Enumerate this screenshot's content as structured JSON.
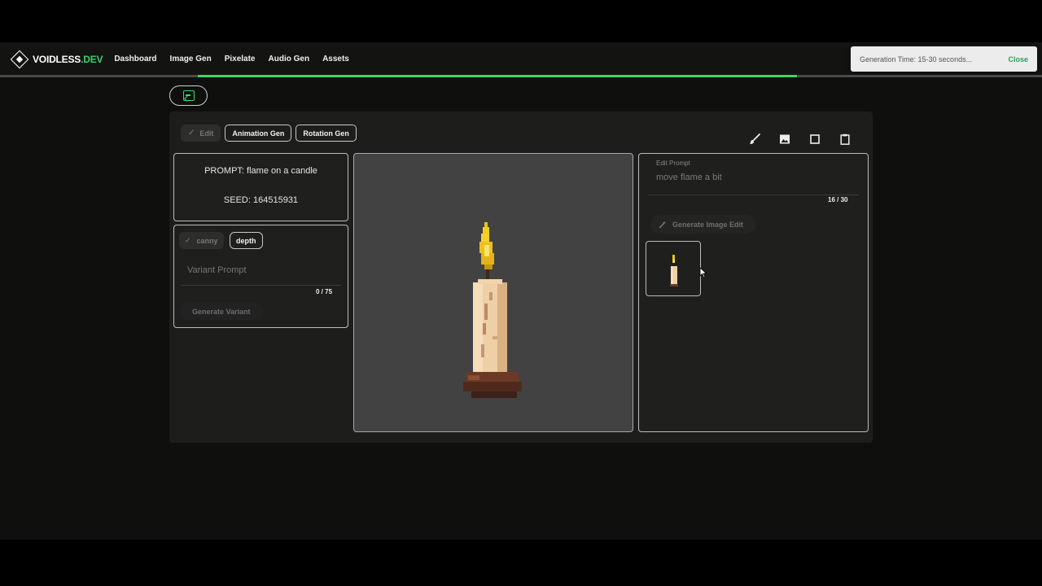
{
  "navbar": {
    "logo_text": "VOIDLESS",
    "logo_suffix": ".DEV",
    "links": [
      "Dashboard",
      "Image Gen",
      "Pixelate",
      "Audio Gen",
      "Assets"
    ],
    "progress_percent": 71
  },
  "toast": {
    "message": "Generation Time: 15-30 seconds...",
    "close_label": "Close"
  },
  "tabs": [
    {
      "label": "Edit",
      "active": true
    },
    {
      "label": "Animation Gen",
      "active": false
    },
    {
      "label": "Rotation Gen",
      "active": false
    }
  ],
  "tools": [
    "brush-icon",
    "image-icon",
    "square-icon",
    "clipboard-icon"
  ],
  "info": {
    "prompt": "PROMPT: flame on a candle",
    "seed": "SEED: 164515931"
  },
  "variant": {
    "chips": [
      {
        "label": "canny",
        "active": true
      },
      {
        "label": "depth",
        "active": false
      }
    ],
    "placeholder": "Variant Prompt",
    "counter": "0 / 75",
    "button_label": "Generate Variant"
  },
  "edit": {
    "field_label": "Edit Prompt",
    "value": "move flame a bit",
    "counter": "16 / 30",
    "button_label": "Generate Image Edit"
  },
  "colors": {
    "accent": "#3ed563",
    "background": "#0f0f0e",
    "card": "#1d1d1c",
    "canvas": "#424242"
  }
}
